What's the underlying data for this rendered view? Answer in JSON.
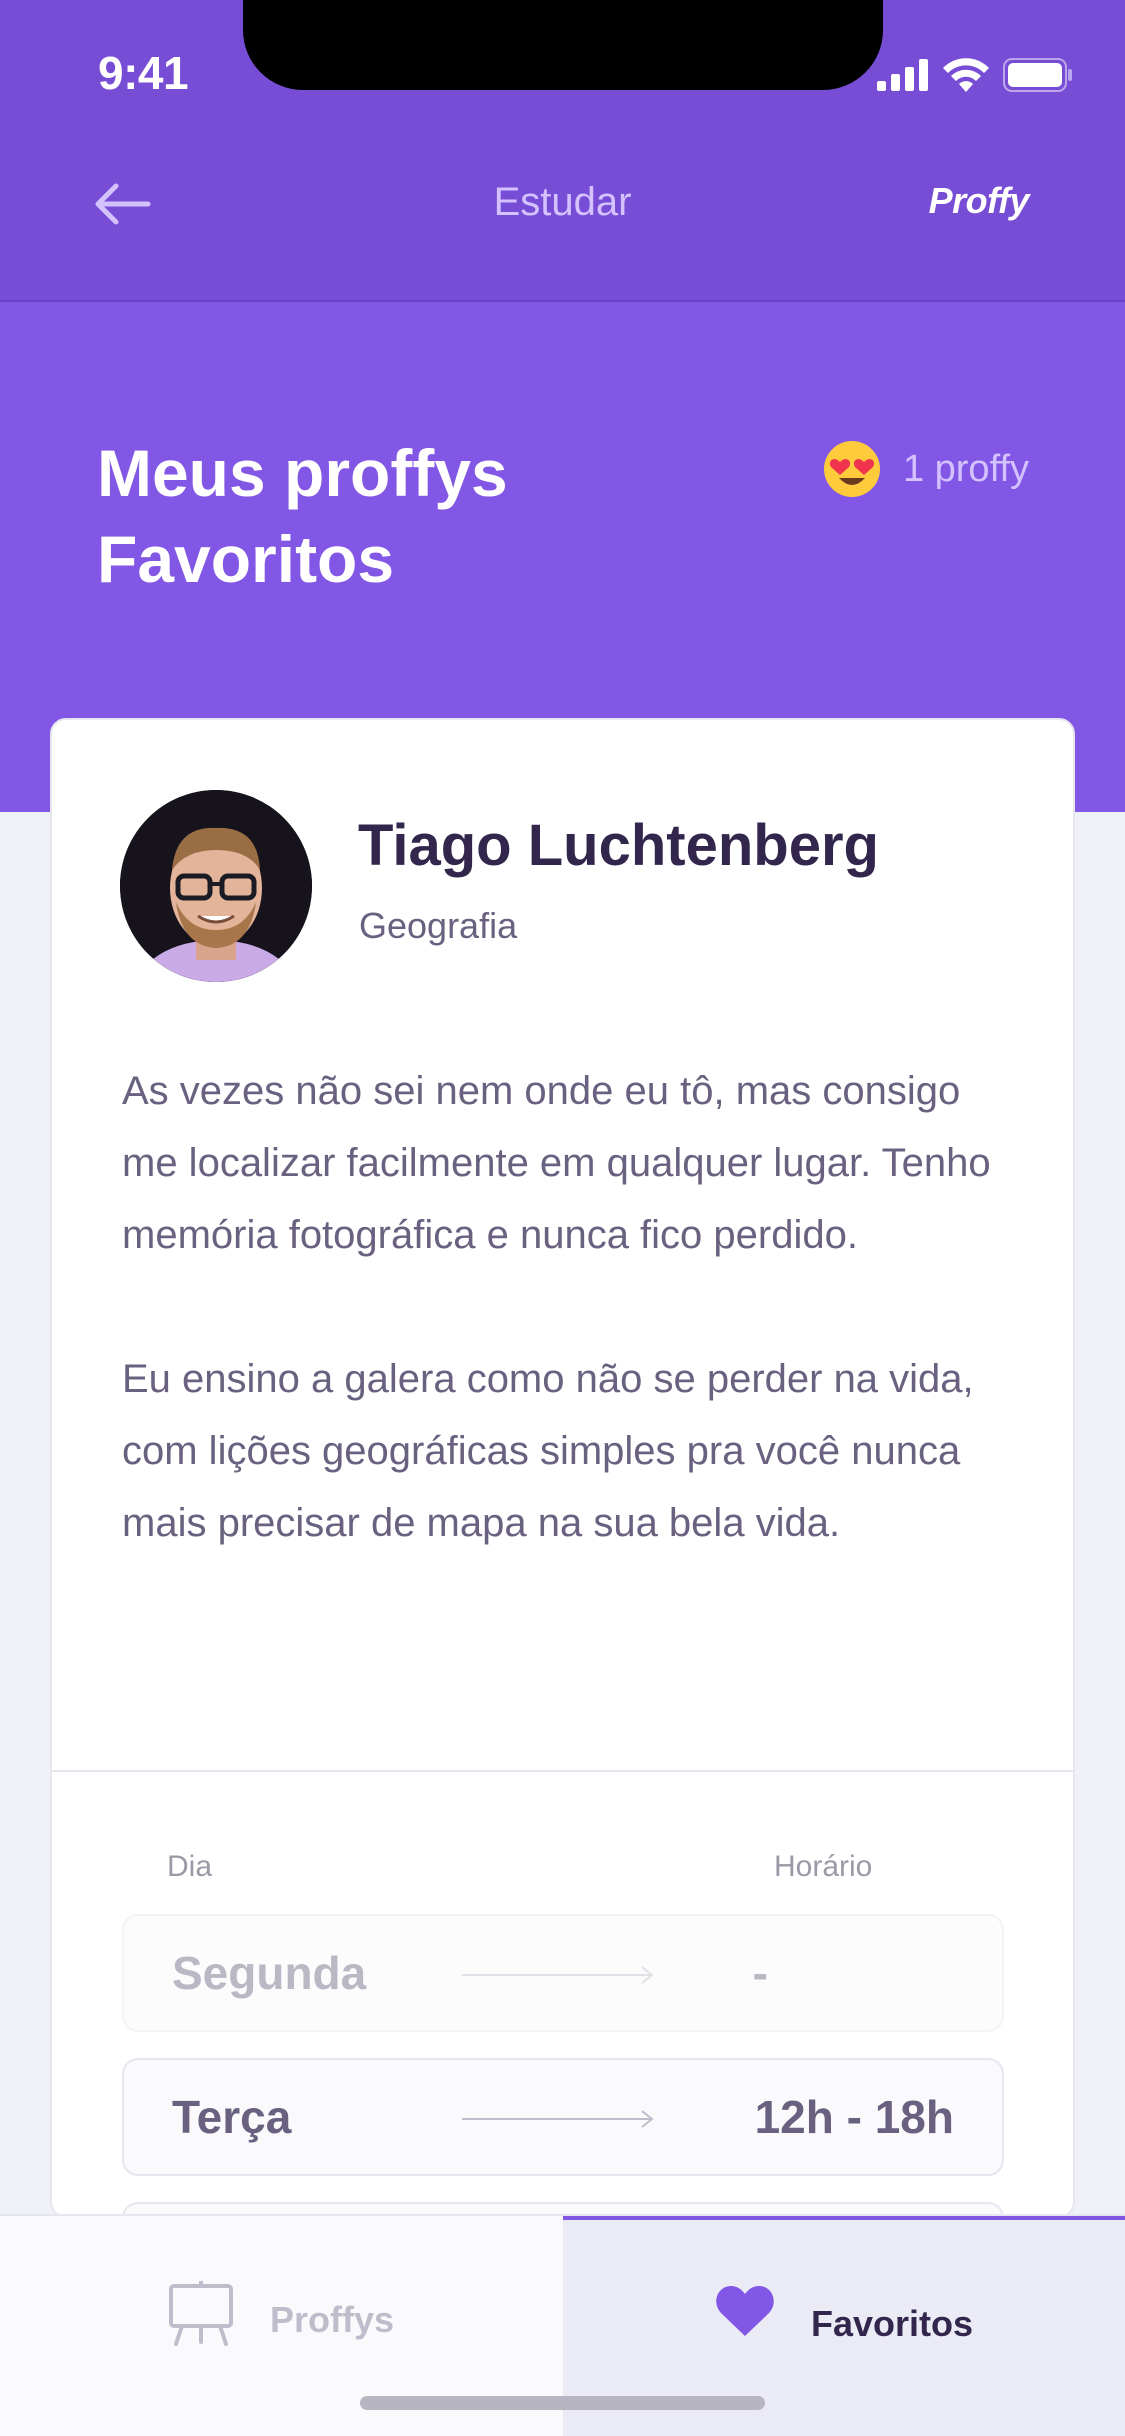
{
  "status_bar": {
    "time": "9:41"
  },
  "nav": {
    "title": "Estudar",
    "brand": "Proffy"
  },
  "header": {
    "title_line1": "Meus proffys",
    "title_line2": "Favoritos",
    "count": "1 proffy"
  },
  "teacher": {
    "name": "Tiago Luchtenberg",
    "subject": "Geografia",
    "bio_p1": "As vezes não sei nem onde eu tô, mas consigo me localizar facilmente em qualquer lugar. Tenho memória fotográfica e nunca fico perdido.",
    "bio_p2": "Eu ensino a galera como não se perder na vida, com lições geográficas simples pra você nunca mais precisar de mapa na sua bela vida."
  },
  "schedule": {
    "day_header": "Dia",
    "time_header": "Horário",
    "rows": [
      {
        "day": "Segunda",
        "time": "-",
        "available": false
      },
      {
        "day": "Terça",
        "time": "12h - 18h",
        "available": true
      }
    ]
  },
  "tabs": [
    {
      "label": "Proffys",
      "active": false
    },
    {
      "label": "Favoritos",
      "active": true
    }
  ],
  "colors": {
    "primary": "#8257E5",
    "primary_dark": "#774DD6",
    "text_title": "#32264D",
    "text_base": "#6A6180"
  }
}
